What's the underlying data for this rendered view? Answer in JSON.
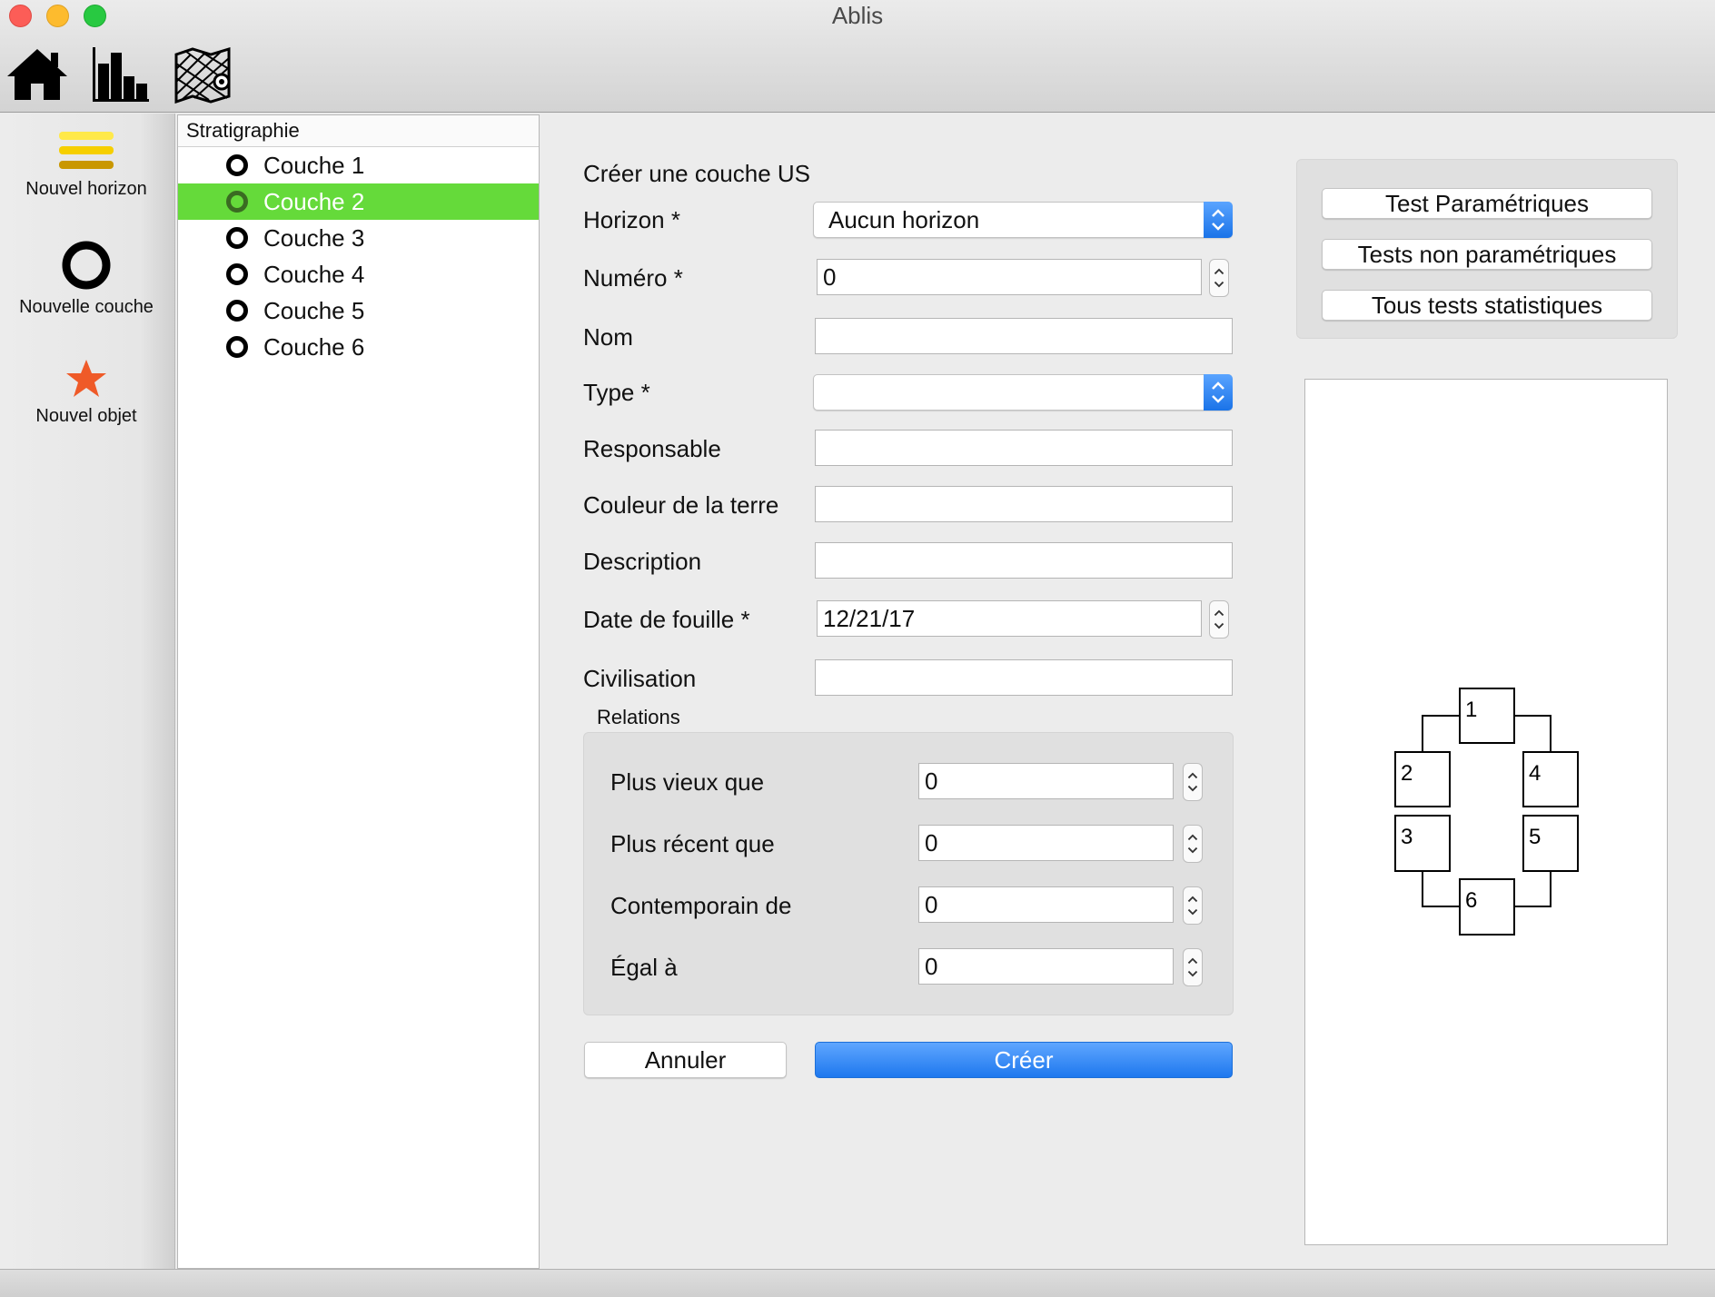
{
  "window": {
    "title": "Ablis"
  },
  "toolbar": {
    "icons": [
      "home-icon",
      "bar-chart-icon",
      "map-icon"
    ]
  },
  "dock": {
    "items": [
      {
        "label": "Nouvel horizon",
        "icon": "horizon-layers-icon"
      },
      {
        "label": "Nouvelle couche",
        "icon": "ring-icon"
      },
      {
        "label": "Nouvel objet",
        "icon": "star-icon"
      }
    ]
  },
  "tree": {
    "header": "Stratigraphie",
    "items": [
      {
        "label": "Couche 1"
      },
      {
        "label": "Couche 2",
        "selected": true
      },
      {
        "label": "Couche 3"
      },
      {
        "label": "Couche 4"
      },
      {
        "label": "Couche 5"
      },
      {
        "label": "Couche 6"
      }
    ]
  },
  "form": {
    "title": "Créer une couche US",
    "horizon": {
      "label": "Horizon *",
      "value": "Aucun horizon"
    },
    "numero": {
      "label": "Numéro *",
      "value": "0"
    },
    "nom": {
      "label": "Nom",
      "value": ""
    },
    "type": {
      "label": "Type *",
      "value": ""
    },
    "responsable": {
      "label": "Responsable",
      "value": ""
    },
    "couleur": {
      "label": "Couleur de la terre",
      "value": ""
    },
    "description": {
      "label": "Description",
      "value": ""
    },
    "date": {
      "label": "Date de fouille *",
      "value": "12/21/17"
    },
    "civilisation": {
      "label": "Civilisation",
      "value": ""
    },
    "relations": {
      "title": "Relations",
      "plus_vieux": {
        "label": "Plus vieux que",
        "value": "0"
      },
      "plus_recent": {
        "label": "Plus récent que",
        "value": "0"
      },
      "contemporain": {
        "label": "Contemporain de",
        "value": "0"
      },
      "egal": {
        "label": "Égal à",
        "value": "0"
      }
    },
    "cancel_label": "Annuler",
    "create_label": "Créer"
  },
  "stats": {
    "buttons": [
      "Test Paramétriques",
      "Tests non paramétriques",
      "Tous tests statistiques"
    ]
  },
  "diagram": {
    "nodes": [
      "1",
      "2",
      "3",
      "4",
      "5",
      "6"
    ]
  },
  "colors": {
    "selection": "#65da3a",
    "accent": "#1e78ee"
  }
}
